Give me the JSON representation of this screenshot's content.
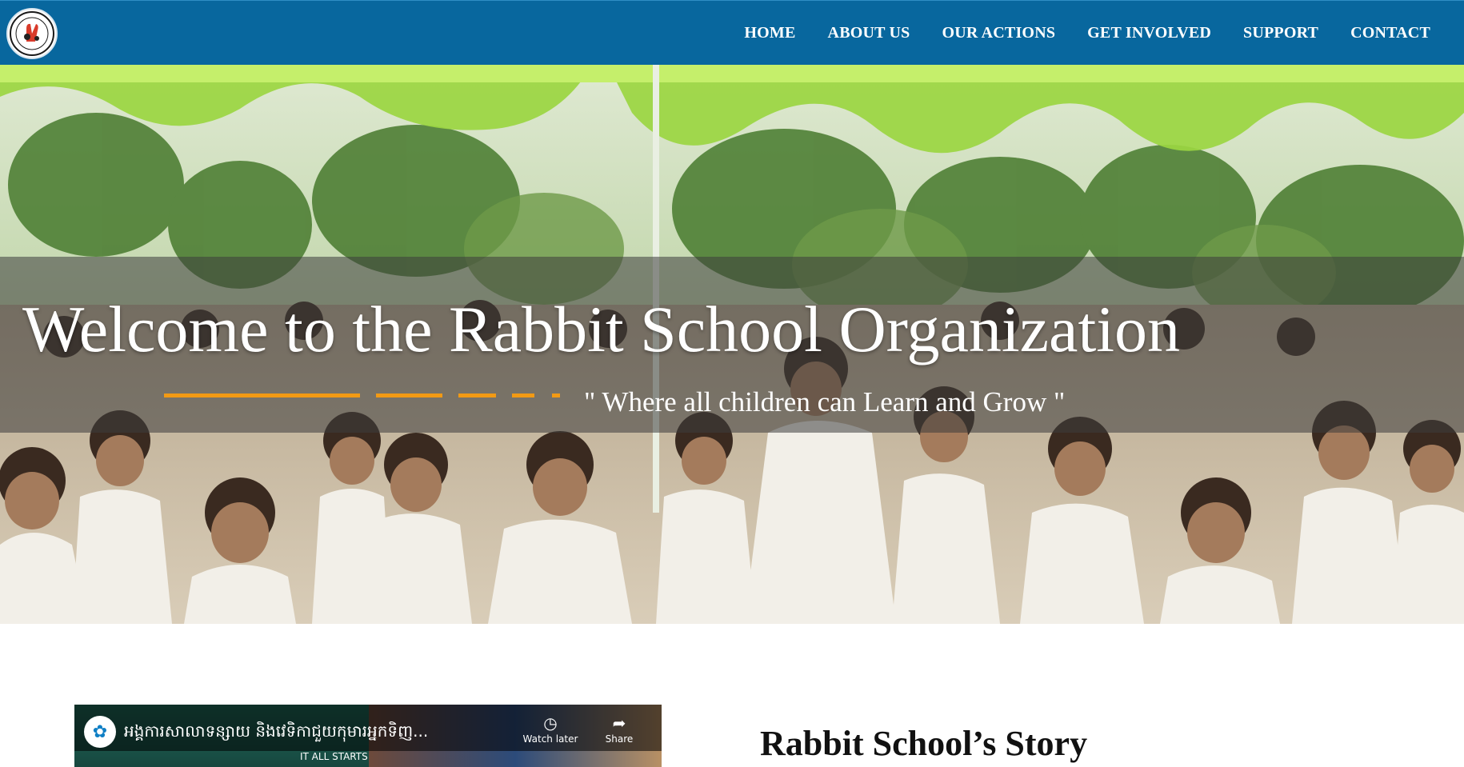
{
  "header": {
    "logo_alt": "The Rabbit School logo",
    "nav": [
      "HOME",
      "ABOUT US",
      "OUR ACTIONS",
      "GET INVOLVED",
      "SUPPORT",
      "CONTACT"
    ]
  },
  "hero": {
    "title": "Welcome to the Rabbit School Organization",
    "tagline": "\" Where all children can Learn and Grow \""
  },
  "video": {
    "title": "អង្គការសាលាទន្សាយ និងវេទិកាជួយកុមារអ្នកទិញ...",
    "subtitle": "IT ALL STARTS",
    "watch_later_label": "Watch later",
    "share_label": "Share"
  },
  "story": {
    "title": "Rabbit School’s Story"
  },
  "colors": {
    "header_bg": "#08679e",
    "accent": "#f29a14"
  }
}
